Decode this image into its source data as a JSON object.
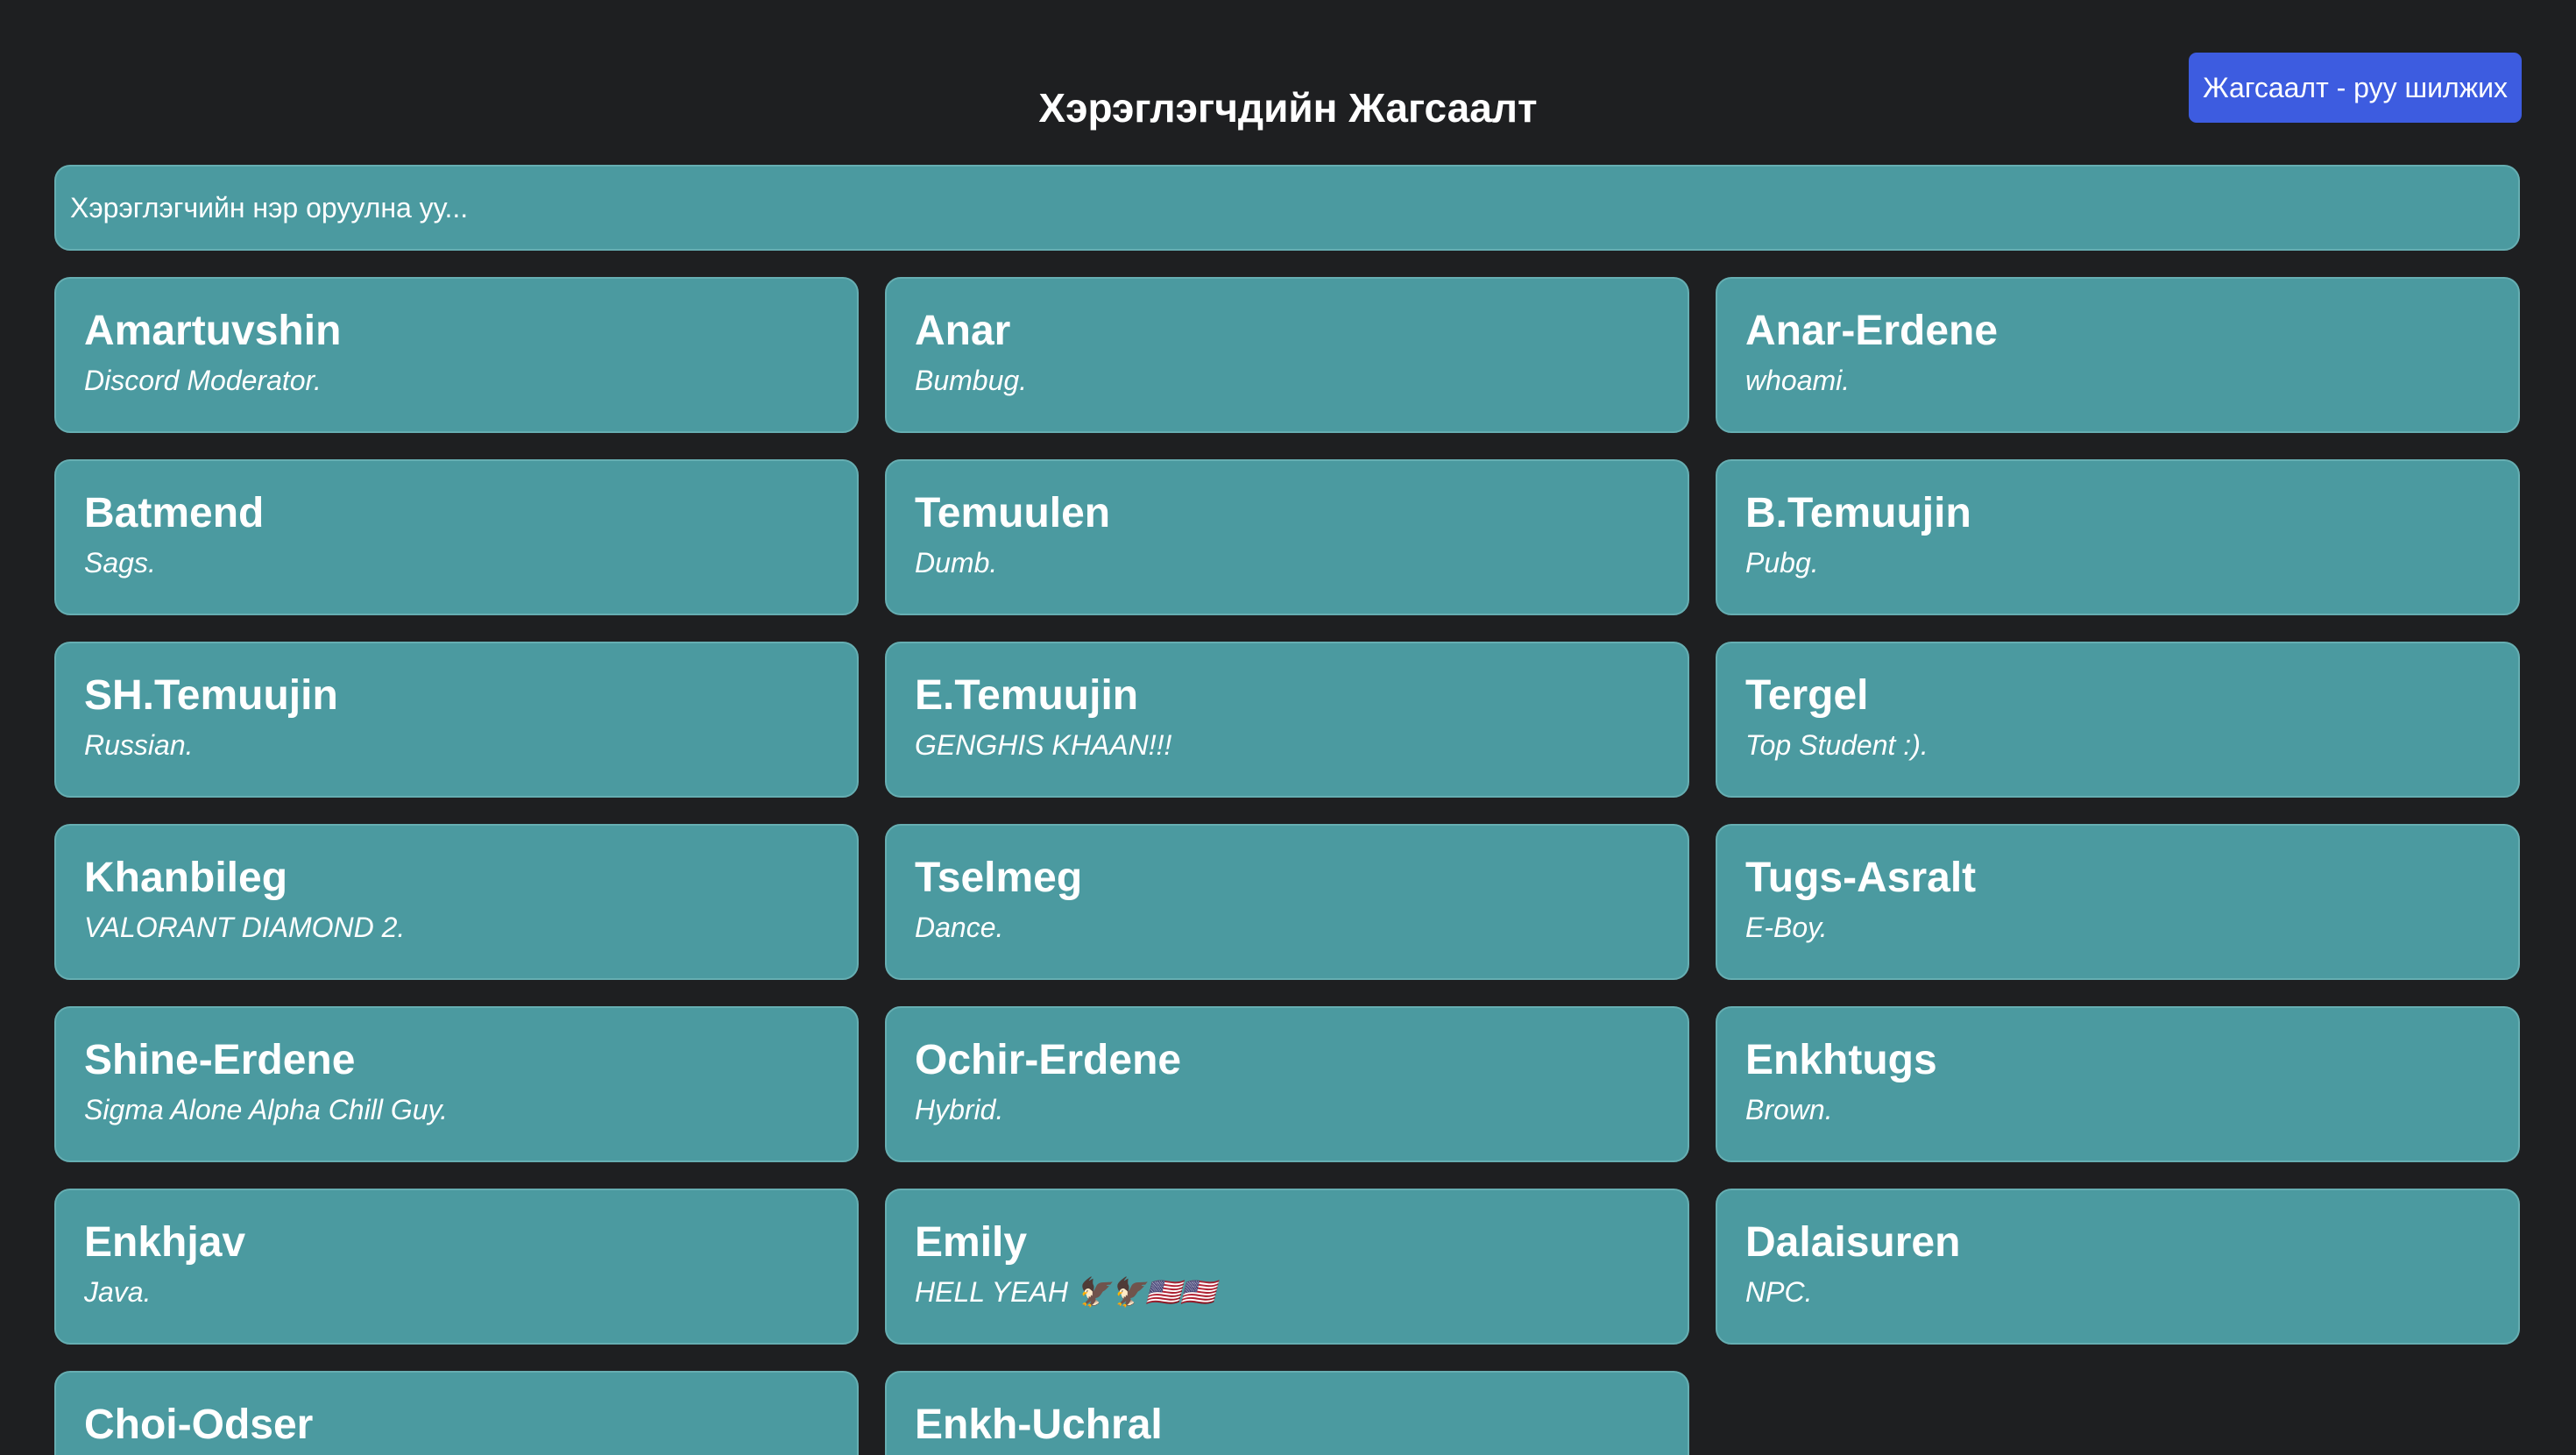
{
  "header": {
    "title": "Хэрэглэгчдийн Жагсаалт",
    "nav_button_label": "Жагсаалт - руу шилжих"
  },
  "search": {
    "placeholder": "Хэрэглэгчийн нэр оруулна уу...",
    "value": ""
  },
  "users": [
    {
      "name": "Amartuvshin",
      "status": "Discord Moderator."
    },
    {
      "name": "Anar",
      "status": "Bumbug."
    },
    {
      "name": "Anar-Erdene",
      "status": "whoami."
    },
    {
      "name": "Batmend",
      "status": "Sags."
    },
    {
      "name": "Temuulen",
      "status": "Dumb."
    },
    {
      "name": "B.Temuujin",
      "status": "Pubg."
    },
    {
      "name": "SH.Temuujin",
      "status": "Russian."
    },
    {
      "name": "E.Temuujin",
      "status": "GENGHIS KHAAN!!!"
    },
    {
      "name": "Tergel",
      "status": "Top Student :)."
    },
    {
      "name": "Khanbileg",
      "status": "VALORANT DIAMOND 2."
    },
    {
      "name": "Tselmeg",
      "status": "Dance."
    },
    {
      "name": "Tugs-Asralt",
      "status": "E-Boy."
    },
    {
      "name": "Shine-Erdene",
      "status": "Sigma Alone Alpha Chill Guy."
    },
    {
      "name": "Ochir-Erdene",
      "status": "Hybrid."
    },
    {
      "name": "Enkhtugs",
      "status": "Brown."
    },
    {
      "name": "Enkhjav",
      "status": "Java."
    },
    {
      "name": "Emily",
      "status": "HELL YEAH 🦅🦅🇺🇸🇺🇸"
    },
    {
      "name": "Dalaisuren",
      "status": "NPC."
    },
    {
      "name": "Choi-Odser",
      "status": ""
    },
    {
      "name": "Enkh-Uchral",
      "status": ""
    }
  ],
  "colors": {
    "background": "#1e1f21",
    "card": "#4b9aa0",
    "accent_button": "#3d5ce0",
    "text": "#ffffff"
  }
}
